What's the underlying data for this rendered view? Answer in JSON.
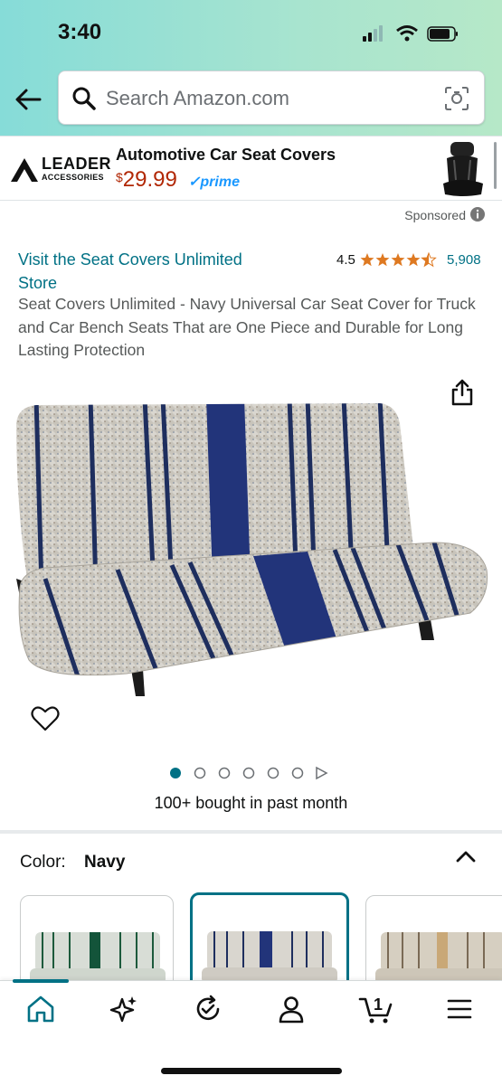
{
  "status_bar": {
    "time": "3:40"
  },
  "search": {
    "placeholder": "Search Amazon.com"
  },
  "ad": {
    "brand_line1": "LEADER",
    "brand_line2": "ACCESSORIES",
    "title": "Automotive Car Seat Covers",
    "price_currency": "$",
    "price_value": "29.99",
    "prime_label": "✓prime"
  },
  "sponsored_label": "Sponsored",
  "product": {
    "store_link": "Visit the Seat Covers Unlimited Store",
    "rating": "4.5",
    "rating_value": 4.5,
    "review_count": "5,908",
    "title": "Seat Covers Unlimited - Navy Universal Car Seat Cover for Truck and Car Bench Seats That are One Piece and Durable for Long Lasting Protection",
    "bought_text": "100+ bought in past month",
    "image_count": 5,
    "current_image": 1
  },
  "color_selector": {
    "label": "Color:",
    "selected": "Navy",
    "swatches": [
      "green",
      "navy",
      "tan"
    ]
  },
  "bottom_nav": {
    "items": [
      "home-icon",
      "sparkle-icon",
      "refresh-check-icon",
      "account-icon",
      "cart-icon",
      "menu-icon"
    ],
    "cart_count": "1"
  },
  "colors": {
    "accent": "#007185",
    "price": "#b12704",
    "star": "#de7921",
    "prime": "#1a98ff"
  }
}
